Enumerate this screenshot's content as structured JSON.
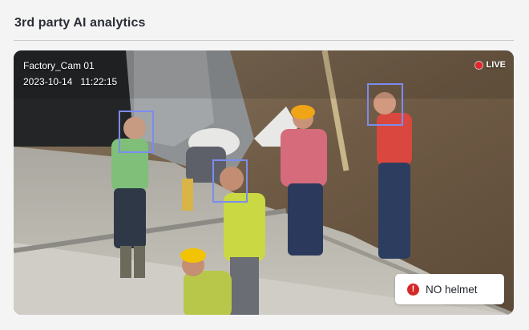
{
  "panel": {
    "title": "3rd party AI analytics"
  },
  "camera": {
    "name": "Factory_Cam 01",
    "date": "2023-10-14",
    "time": "11:22:15",
    "live_label": "LIVE"
  },
  "alert": {
    "icon": "alert-circle-icon",
    "label": "NO helmet",
    "color": "#d62828"
  },
  "detections": {
    "box_color": "#7b8cf0",
    "count": 3
  },
  "colors": {
    "live_dot": "#e5252a",
    "background": "#f4f4f5"
  }
}
